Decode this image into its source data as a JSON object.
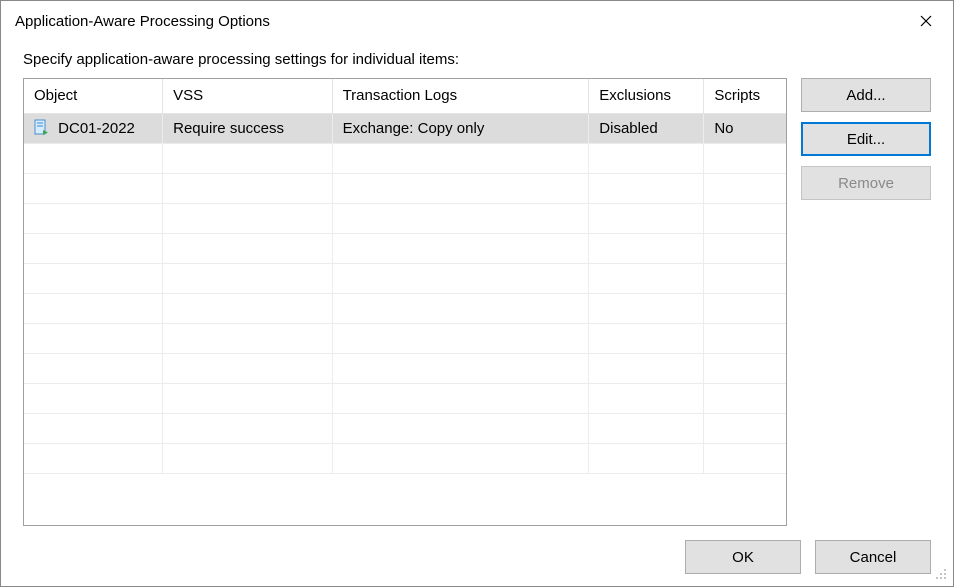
{
  "window": {
    "title": "Application-Aware Processing Options"
  },
  "instruction": "Specify application-aware processing settings for individual items:",
  "table": {
    "headers": {
      "object": "Object",
      "vss": "VSS",
      "tlogs": "Transaction Logs",
      "exclusions": "Exclusions",
      "scripts": "Scripts"
    },
    "rows": [
      {
        "object": "DC01-2022",
        "vss": "Require success",
        "tlogs": "Exchange: Copy only",
        "exclusions": "Disabled",
        "scripts": "No",
        "selected": true
      }
    ]
  },
  "buttons": {
    "add": "Add...",
    "edit": "Edit...",
    "remove": "Remove",
    "ok": "OK",
    "cancel": "Cancel"
  }
}
